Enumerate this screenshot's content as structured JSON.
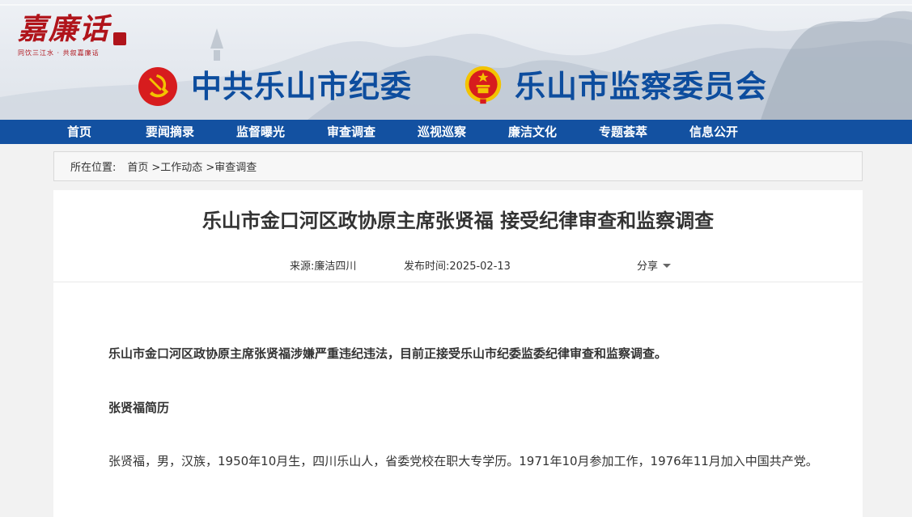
{
  "banner": {
    "logo_text": "嘉廉话",
    "logo_slogan": "同饮三江水 · 共叙嘉廉话",
    "left_title": "中共乐山市纪委",
    "right_title": "乐山市监察委员会"
  },
  "nav": {
    "items": [
      {
        "label": "首页"
      },
      {
        "label": "要闻摘录"
      },
      {
        "label": "监督曝光"
      },
      {
        "label": "审查调查"
      },
      {
        "label": "巡视巡察"
      },
      {
        "label": "廉洁文化"
      },
      {
        "label": "专题荟萃"
      },
      {
        "label": "信息公开"
      }
    ]
  },
  "breadcrumb": {
    "label": "所在位置:",
    "items": [
      "首页",
      ">工作动态",
      ">审查调查"
    ]
  },
  "article": {
    "title": "乐山市金口河区政协原主席张贤福 接受纪律审查和监察调查",
    "source": "来源:廉洁四川",
    "date": "发布时间:2025-02-13",
    "share": "分享",
    "paragraphs": [
      "乐山市金口河区政协原主席张贤福涉嫌严重违纪违法，目前正接受乐山市纪委监委纪律审查和监察调查。",
      "张贤福简历",
      "张贤福，男，汉族，1950年10月生，四川乐山人，省委党校在职大专学历。1971年10月参加工作，1976年11月加入中国共产党。"
    ]
  },
  "colors": {
    "nav_bg": "#1351a1",
    "title_blue": "#0d4d9e",
    "logo_red": "#b0141b",
    "emblem_red": "#d71c1e",
    "emblem_gold": "#f3c300"
  }
}
